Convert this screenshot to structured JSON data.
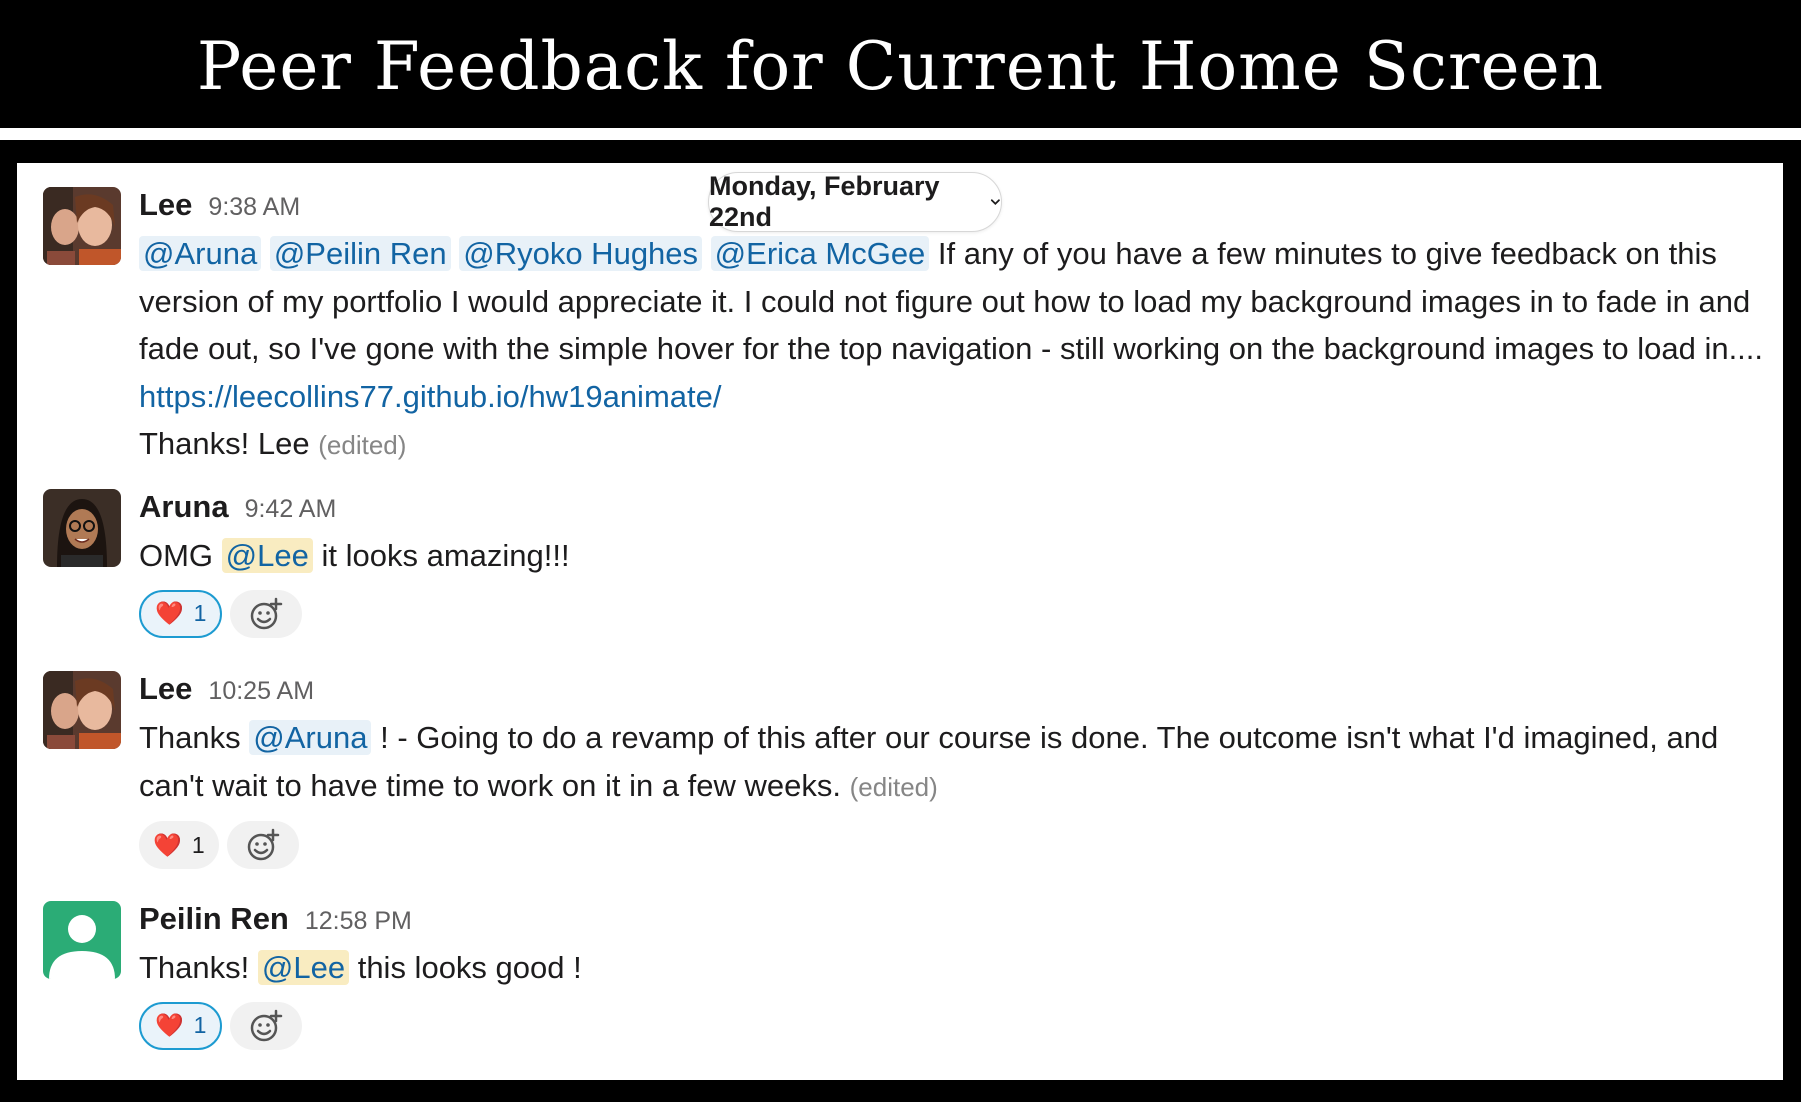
{
  "banner": {
    "title": "Peer Feedback for Current Home Screen"
  },
  "date_divider": {
    "label": "Monday, February 22nd"
  },
  "messages": [
    {
      "author": "Lee",
      "time": "9:38 AM",
      "mentions": [
        "@Aruna",
        "@Peilin Ren",
        "@Ryoko Hughes",
        "@Erica McGee"
      ],
      "text": " If any of you have a few minutes to give feedback on this version of my portfolio I would appreciate it. I could not figure out how to load my background images in to fade in and fade out, so I've gone with the simple hover for the top navigation - still working on the background images to load in.... ",
      "link": "https://leecollins77.github.io/hw19animate/",
      "signoff": "Thanks! Lee",
      "edited": "(edited)"
    },
    {
      "author": "Aruna",
      "time": "9:42 AM",
      "pre": "OMG ",
      "mention": "@Lee",
      "post": " it looks amazing!!!",
      "reaction_emoji": "❤️",
      "reaction_count": "1"
    },
    {
      "author": "Lee",
      "time": "10:25 AM",
      "pre": "Thanks ",
      "mention": "@Aruna",
      "post": " ! - Going to do a revamp of this after our course is done. The outcome isn't what I'd imagined, and can't wait to have time to work on it in a few weeks. ",
      "edited": "(edited)",
      "reaction_emoji": "❤️",
      "reaction_count": "1"
    },
    {
      "author": "Peilin Ren",
      "time": "12:58 PM",
      "pre": "Thanks! ",
      "mention": "@Lee",
      "post": " this looks good !",
      "reaction_emoji": "❤️",
      "reaction_count": "1"
    }
  ],
  "icons": {
    "add_reaction": "add-reaction-icon",
    "heart": "heart-emoji",
    "date_chevron": "chevron-down-icon"
  },
  "colors": {
    "mention_bg": "#e8f1f8",
    "self_mention_bg": "#f9ecc1",
    "link": "#1264a3",
    "active_reaction_border": "#1d9bd1",
    "default_avatar": "#2bac76"
  }
}
